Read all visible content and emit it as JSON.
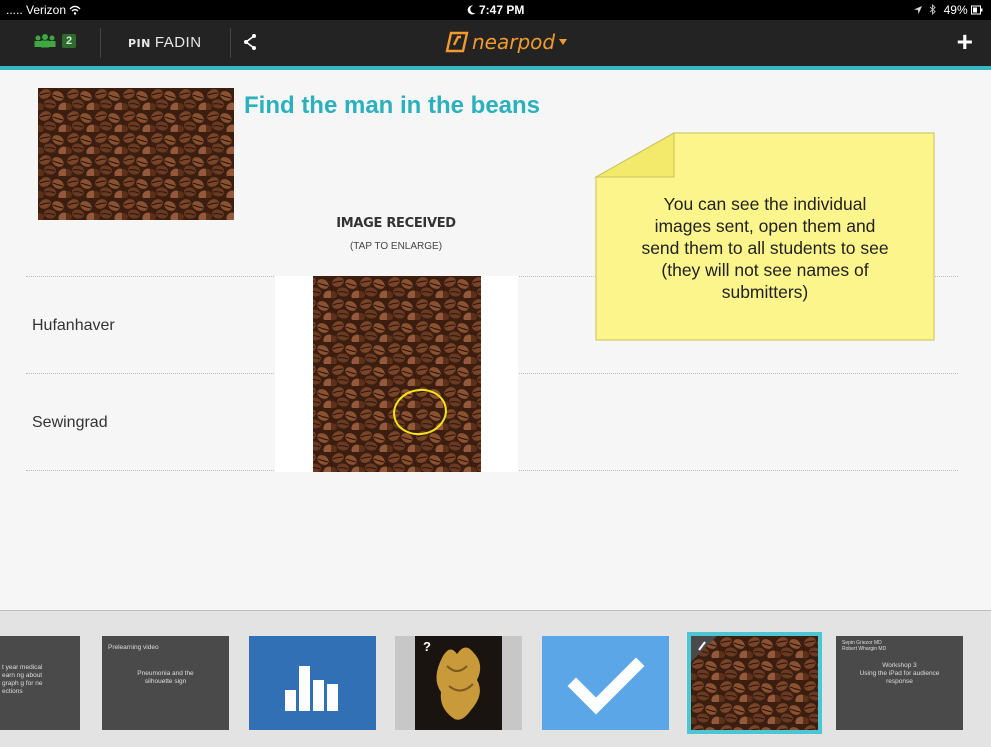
{
  "status_bar": {
    "carrier": "..... Verizon",
    "time": "7:47 PM",
    "battery": "49%"
  },
  "nav": {
    "user_count": "2",
    "pin_label": "PIN",
    "pin_code": "FADIN",
    "brand": "nearpod"
  },
  "main": {
    "title": "Find the man in the beans",
    "image_received": "IMAGE RECEIVED",
    "tap_to_enlarge": "(TAP TO ENLARGE)",
    "students": [
      {
        "name": "Hufanhaver"
      },
      {
        "name": "Sewingrad"
      }
    ]
  },
  "callout": {
    "lines": [
      "You can see the individual",
      "images sent, open them and",
      "send them to all students to see",
      "(they will not see names of",
      "submitters)"
    ]
  },
  "slides": {
    "s1": [
      "t year medical",
      "earn ng about",
      "graph g for ne",
      "ections"
    ],
    "s2_title": "Prelearning video",
    "s2_body": [
      "Pneumonia and the",
      "silhouette sign"
    ],
    "s4_badge": "?",
    "s7": [
      "Sepin Griezor MD",
      "Robert Whargin MD",
      "",
      "Workshop 3",
      "Using the iPad for audience",
      "response"
    ]
  },
  "colors": {
    "accent": "#35b7c1",
    "title": "#2bb0be",
    "brand": "#f39a2e",
    "note": "#fbf58c",
    "chart_slide": "#3170b5",
    "quiz_slide": "#5ba6e6"
  }
}
